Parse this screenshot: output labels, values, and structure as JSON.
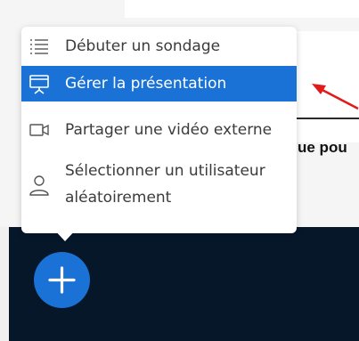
{
  "background": {
    "partial_text": "ue pou",
    "dark_color": "#06172a"
  },
  "menu": {
    "items": [
      {
        "label": "Débuter un sondage",
        "icon": "poll-list-icon",
        "active": false
      },
      {
        "label": "Gérer la présentation",
        "icon": "presentation-icon",
        "active": true
      },
      {
        "label": "Partager une vidéo externe",
        "icon": "video-camera-icon",
        "active": false
      },
      {
        "label_line1": "Sélectionner un utilisateur",
        "label_line2": "aléatoirement",
        "icon": "user-icon",
        "active": false
      }
    ]
  },
  "fab": {
    "icon": "plus-icon",
    "color": "#1b72d6"
  },
  "accent_color": "#1b72d6",
  "annotation": {
    "icon": "red-arrow-icon",
    "color": "#e11a1a"
  }
}
